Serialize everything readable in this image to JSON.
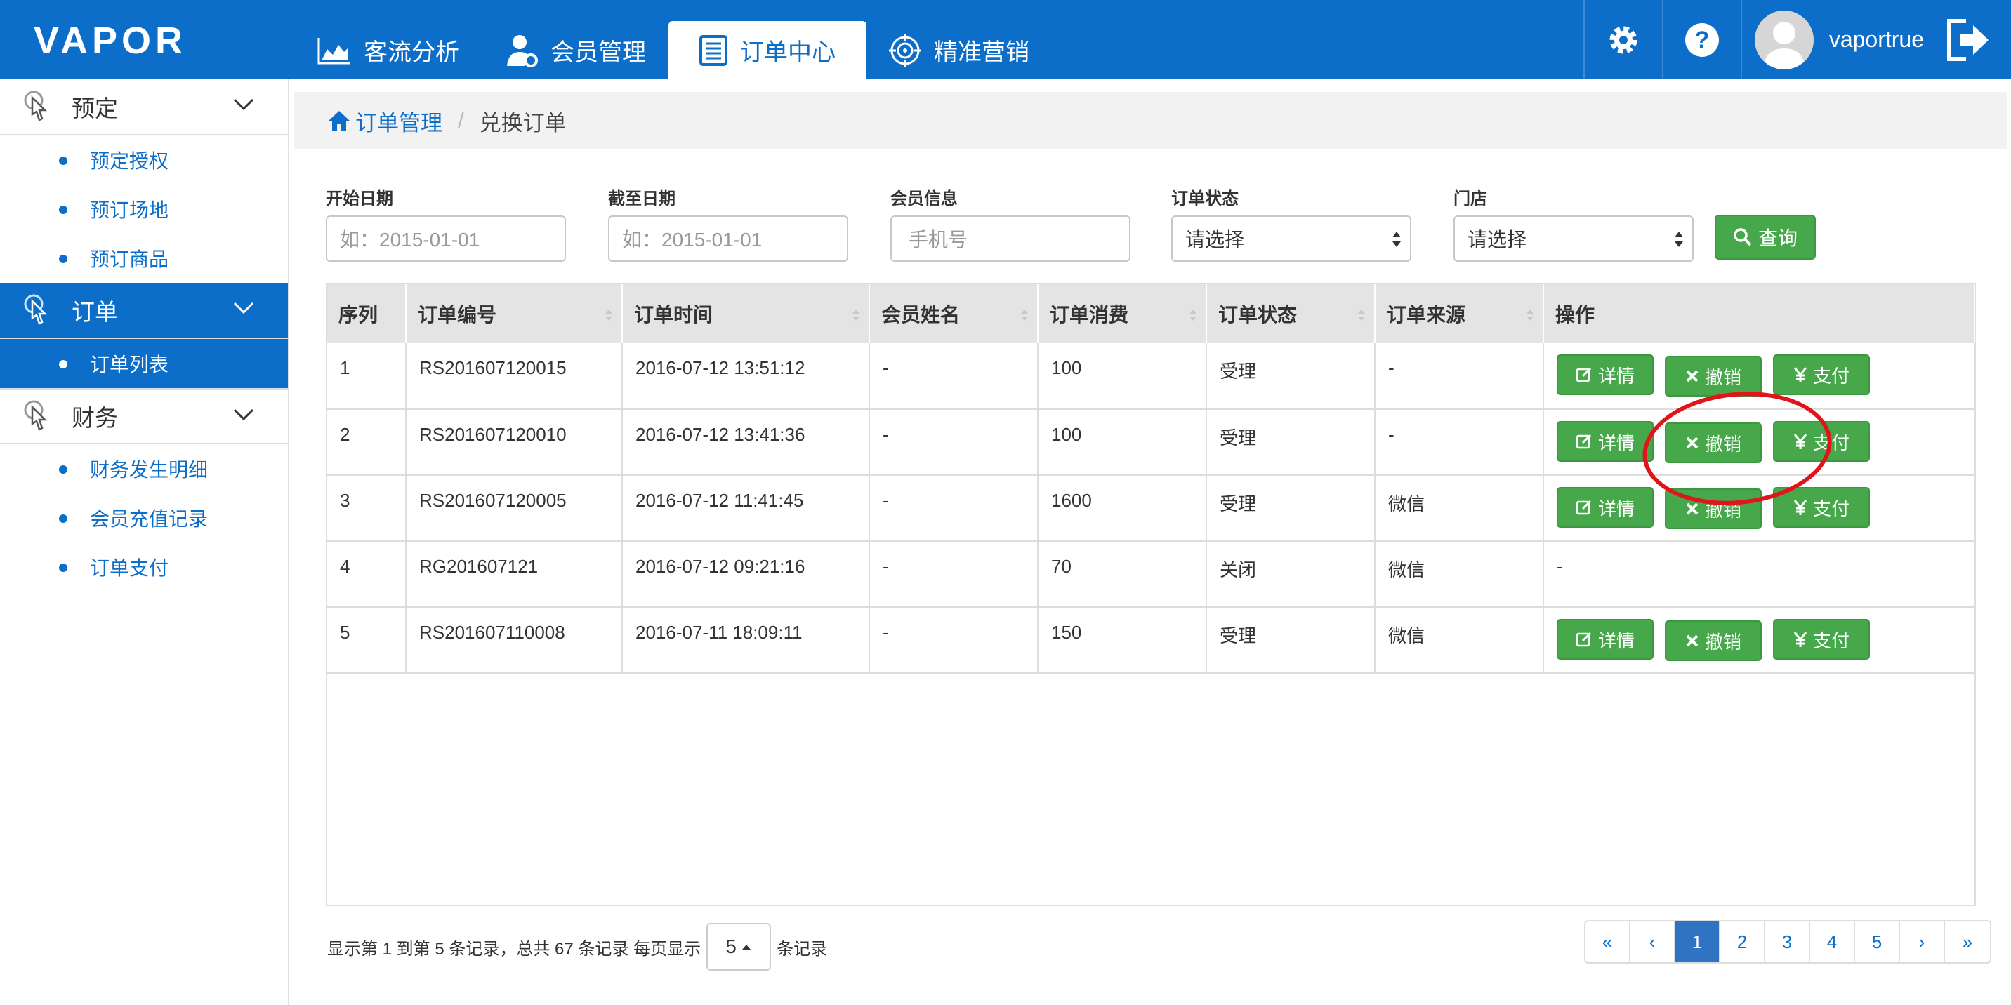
{
  "header": {
    "logo": "VAPOR",
    "nav": [
      {
        "label": "客流分析"
      },
      {
        "label": "会员管理"
      },
      {
        "label": "订单中心"
      },
      {
        "label": "精准营销"
      }
    ],
    "username": "vaportrue",
    "brand_color": "#0c6ec9"
  },
  "sidebar": {
    "groups": [
      {
        "label": "预定",
        "items": [
          "预定授权",
          "预订场地",
          "预订商品"
        ]
      },
      {
        "label": "订单",
        "items": [
          "订单列表"
        ]
      },
      {
        "label": "财务",
        "items": [
          "财务发生明细",
          "会员充值记录",
          "订单支付"
        ]
      }
    ]
  },
  "breadcrumb": {
    "home": "订单管理",
    "current": "兑换订单"
  },
  "filters": {
    "start_label": "开始日期",
    "start_placeholder": "如：2015-01-01",
    "end_label": "截至日期",
    "end_placeholder": "如：2015-01-01",
    "member_label": "会员信息",
    "member_placeholder": "手机号",
    "status_label": "订单状态",
    "status_value": "请选择",
    "store_label": "门店",
    "store_value": "请选择",
    "query_label": "查询"
  },
  "table": {
    "headers": [
      "序列",
      "订单编号",
      "订单时间",
      "会员姓名",
      "订单消费",
      "订单状态",
      "订单来源",
      "操作"
    ],
    "rows": [
      {
        "seq": "1",
        "no": "RS201607120015",
        "time": "2016-07-12 13:51:12",
        "name": "-",
        "amount": "100",
        "status": "受理",
        "source": "-"
      },
      {
        "seq": "2",
        "no": "RS201607120010",
        "time": "2016-07-12 13:41:36",
        "name": "-",
        "amount": "100",
        "status": "受理",
        "source": "-"
      },
      {
        "seq": "3",
        "no": "RS201607120005",
        "time": "2016-07-12 11:41:45",
        "name": "-",
        "amount": "1600",
        "status": "受理",
        "source": "微信"
      },
      {
        "seq": "4",
        "no": "RG201607121",
        "time": "2016-07-12 09:21:16",
        "name": "-",
        "amount": "70",
        "status": "关闭",
        "source": "微信",
        "ops_text": "-"
      },
      {
        "seq": "5",
        "no": "RS201607110008",
        "time": "2016-07-11 18:09:11",
        "name": "-",
        "amount": "150",
        "status": "受理",
        "source": "微信"
      }
    ],
    "btn_detail": "详情",
    "btn_cancel": "撤销",
    "btn_pay": "支付"
  },
  "footer": {
    "info": "显示第 1 到第 5 条记录，总共 67 条记录 每页显示",
    "page_size": "5",
    "suffix": "条记录",
    "pages": [
      "«",
      "‹",
      "1",
      "2",
      "3",
      "4",
      "5",
      "›",
      "»"
    ]
  },
  "annotation_color": "#e0141b"
}
